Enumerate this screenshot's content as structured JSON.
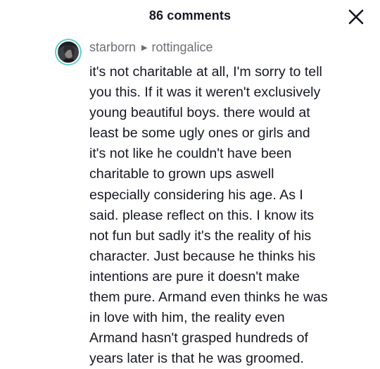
{
  "header": {
    "title": "86 comments",
    "close_icon": "close-icon"
  },
  "comment": {
    "avatar_icon": "avatar",
    "ring_color": "#5fd0c6",
    "author": "starborn",
    "reply_arrow_icon": "play-arrow-icon",
    "reply_to": "rottingalice",
    "text": "it's not charitable at all, I'm sorry to tell\nyou this. If it was it weren't exclusively\nyoung beautiful boys. there would at\nleast be some ugly ones or girls and\nit's not like he couldn't have been\ncharitable to grown ups aswell\nespecially considering his age. As I\nsaid. please reflect on this. I know its\nnot fun but sadly it's the reality of his\ncharacter. Just because he thinks his\nintentions are pure it doesn't make\nthem pure. Armand even thinks he was\nin love with him, the reality even\nArmand hasn't grasped hundreds of\nyears later is that he was groomed."
  }
}
